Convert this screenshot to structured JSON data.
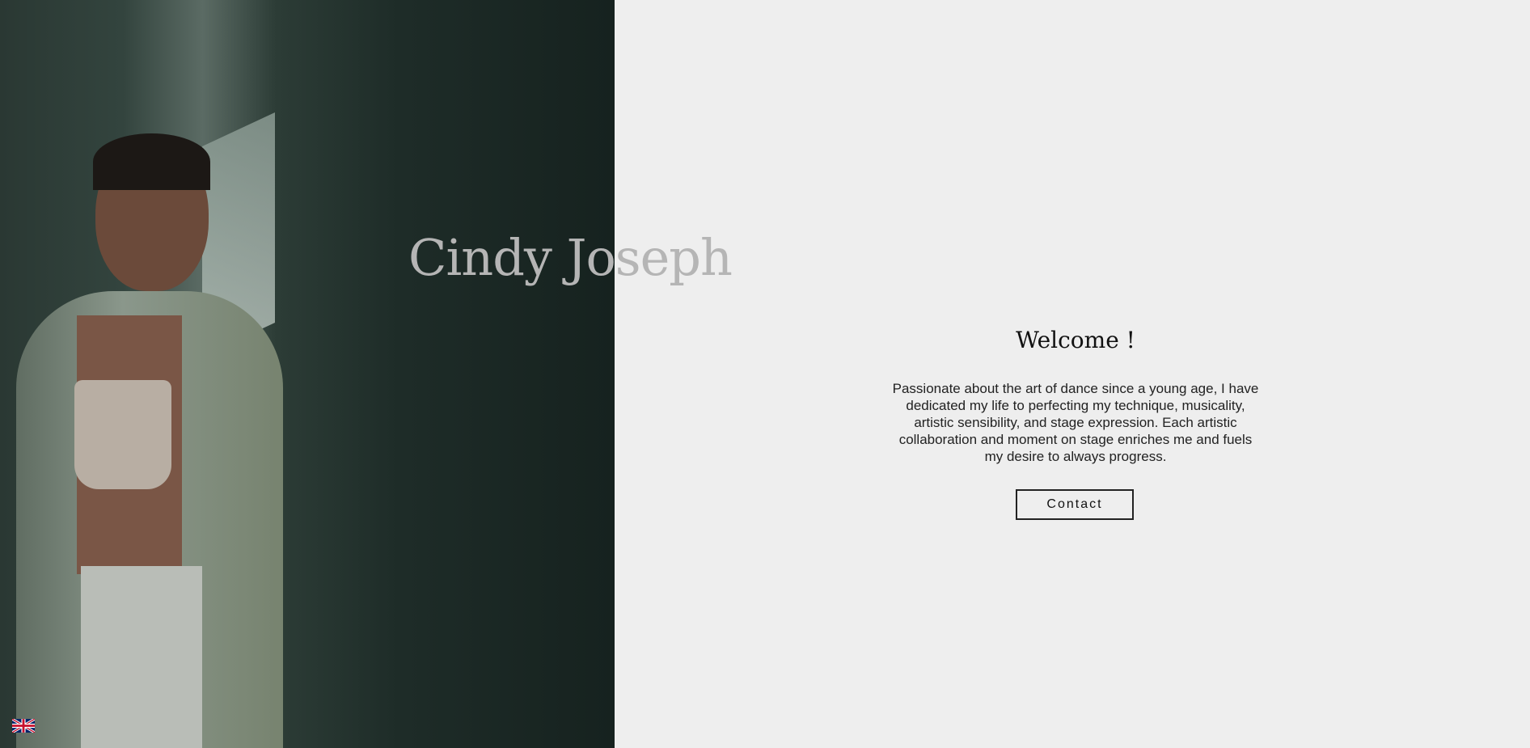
{
  "hero": {
    "name": "Cindy Joseph",
    "photo_description_icon": "portrait-photo"
  },
  "intro": {
    "heading": "Welcome !",
    "paragraph": "Passionate about the art of dance since a young age, I have dedicated my life to perfecting my technique, musicality, artistic sensibility, and stage expression. Each artistic collaboration and moment on stage enriches me and fuels my desire to always progress.",
    "contact_label": "Contact"
  },
  "language": {
    "icon": "uk-flag-icon"
  },
  "colors": {
    "background": "#eeeeee",
    "photo_tone": "#1e2c28",
    "title": "#b5b5b5"
  }
}
